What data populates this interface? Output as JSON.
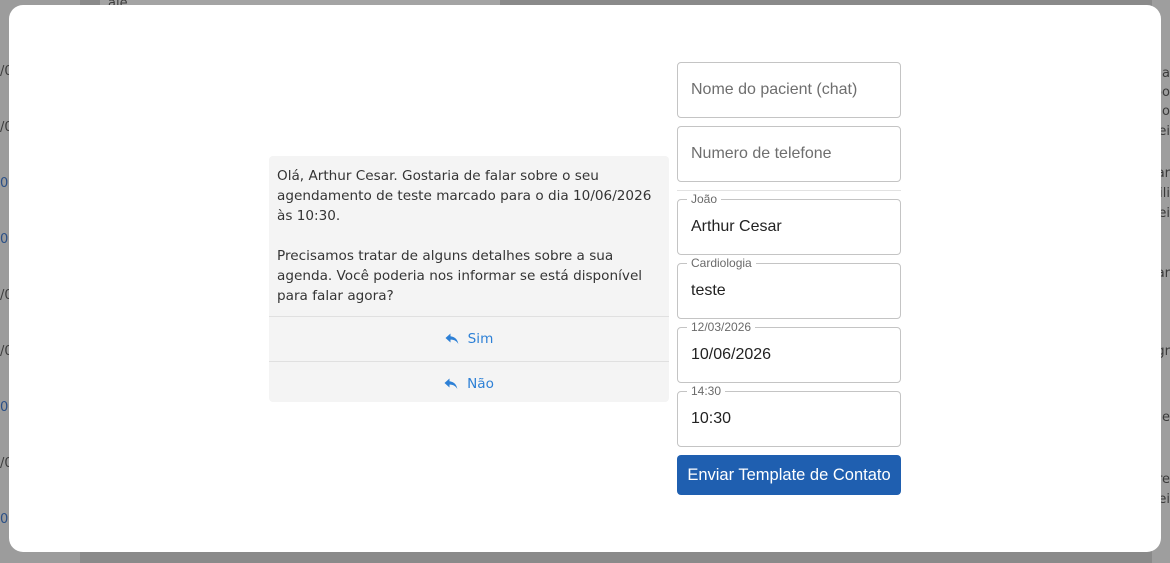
{
  "background": {
    "left_fragments": [
      "ale",
      "/0",
      "/0",
      "0",
      "0",
      "/0",
      "/0",
      "0",
      "/0",
      "0",
      "/0"
    ],
    "right_fragments": [
      "a",
      "bo",
      "io",
      "ei",
      "ar",
      "ili",
      "ei",
      "ar",
      "ei",
      "gr",
      "a",
      "ge",
      "ei",
      "re",
      "ei",
      "ei"
    ]
  },
  "chat_preview": {
    "message_paragraph_1": "Olá, Arthur Cesar. Gostaria de falar sobre o seu agendamento de teste marcado para o dia 10/06/2026 às 10:30.",
    "message_paragraph_2": "Precisamos tratar de alguns detalhes sobre a sua agenda. Você poderia nos informar se está disponível para falar agora?",
    "replies": [
      {
        "label": "Sim",
        "icon": "reply-icon"
      },
      {
        "label": "Não",
        "icon": "reply-icon"
      }
    ]
  },
  "form": {
    "patient_name": {
      "placeholder": "Nome do pacient (chat)",
      "value": ""
    },
    "phone": {
      "placeholder": "Numero de telefone",
      "value": ""
    },
    "name_field": {
      "label": "João",
      "value": "Arthur Cesar"
    },
    "specialty_field": {
      "label": "Cardiologia",
      "value": "teste"
    },
    "date_field": {
      "label": "12/03/2026",
      "value": "10/06/2026"
    },
    "time_field": {
      "label": "14:30",
      "value": "10:30"
    },
    "submit_label": "Enviar Template de Contato"
  },
  "colors": {
    "accent": "#1f5fb0",
    "reply_link": "#2d80d6",
    "overlay": "#8a8a8a"
  }
}
